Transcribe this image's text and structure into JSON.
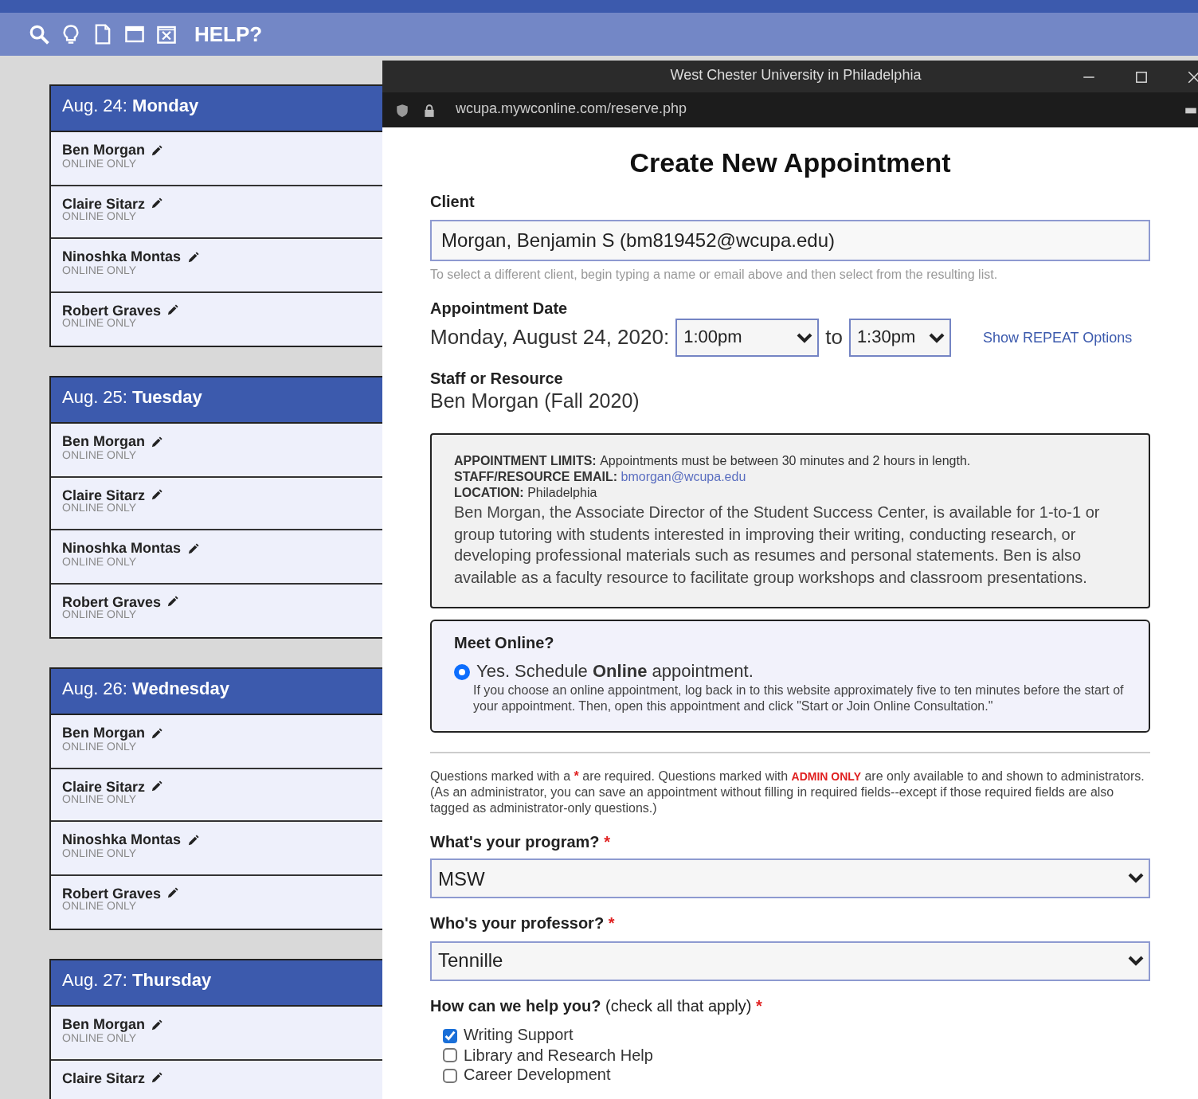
{
  "toolbar": {
    "help": "HELP?"
  },
  "schedule": {
    "days": [
      {
        "date": "Aug. 24:",
        "weekday": "Monday",
        "slots": [
          {
            "name": "Ben Morgan",
            "note": "ONLINE ONLY"
          },
          {
            "name": "Claire Sitarz",
            "note": "ONLINE ONLY"
          },
          {
            "name": "Ninoshka Montas",
            "note": "ONLINE ONLY"
          },
          {
            "name": "Robert Graves",
            "note": "ONLINE ONLY"
          }
        ]
      },
      {
        "date": "Aug. 25:",
        "weekday": "Tuesday",
        "slots": [
          {
            "name": "Ben Morgan",
            "note": "ONLINE ONLY"
          },
          {
            "name": "Claire Sitarz",
            "note": "ONLINE ONLY"
          },
          {
            "name": "Ninoshka Montas",
            "note": "ONLINE ONLY"
          },
          {
            "name": "Robert Graves",
            "note": "ONLINE ONLY"
          }
        ]
      },
      {
        "date": "Aug. 26:",
        "weekday": "Wednesday",
        "slots": [
          {
            "name": "Ben Morgan",
            "note": "ONLINE ONLY"
          },
          {
            "name": "Claire Sitarz",
            "note": "ONLINE ONLY"
          },
          {
            "name": "Ninoshka Montas",
            "note": "ONLINE ONLY"
          },
          {
            "name": "Robert Graves",
            "note": "ONLINE ONLY"
          }
        ]
      },
      {
        "date": "Aug. 27:",
        "weekday": "Thursday",
        "slots": [
          {
            "name": "Ben Morgan",
            "note": "ONLINE ONLY"
          },
          {
            "name": "Claire Sitarz"
          }
        ]
      }
    ]
  },
  "window": {
    "title": "West Chester University in Philadelphia",
    "url": "wcupa.mywconline.com/reserve.php"
  },
  "form": {
    "title": "Create New Appointment",
    "client": {
      "label": "Client",
      "value": "Morgan, Benjamin S (bm819452@wcupa.edu)",
      "hint": "To select a different client, begin typing a name or email above and then select from the resulting list."
    },
    "date": {
      "label": "Appointment Date",
      "value": "Monday, August 24, 2020:",
      "start": "1:00pm",
      "separator": "to",
      "end": "1:30pm",
      "repeat_link": "Show REPEAT Options"
    },
    "staff": {
      "label": "Staff or Resource",
      "value": "Ben Morgan (Fall 2020)"
    },
    "info": {
      "lines": [
        {
          "label": "APPOINTMENT LIMITS:",
          "value": "Appointments must be between 30 minutes and 2 hours in length.",
          "kind": "text"
        },
        {
          "label": "STAFF/RESOURCE EMAIL:",
          "value": "bmorgan@wcupa.edu",
          "kind": "link"
        },
        {
          "label": "LOCATION:",
          "value": "Philadelphia",
          "kind": "text"
        }
      ],
      "description": "Ben Morgan, the Associate Director of the Student Success Center, is available for 1-to-1 or group tutoring with students interested in improving their writing, conducting research, or developing professional materials such as resumes and personal statements. Ben is also available as a faculty resource to facilitate group workshops and classroom presentations."
    },
    "meet_online": {
      "title": "Meet Online?",
      "option": {
        "label": "Yes. Schedule **Online** appointment.",
        "selected": true
      },
      "description": "If you choose an online appointment, log back in to this website approximately five to ten minutes before the start of your appointment. Then, open this appointment and click \"Start or Join Online Consultation.\""
    },
    "notice": {
      "before": "Questions marked with a ",
      "required_mark": "*",
      "middle": " are required. Questions marked with ",
      "admin_tag": "ADMIN ONLY",
      "after": " are only available to and shown to administrators. (As an administrator, you can save an appointment without filling in required fields--except if those required fields are also tagged as administrator-only questions.)"
    },
    "questions": [
      {
        "kind": "select",
        "label": "What's your program?",
        "required_mark": "*",
        "value": "MSW"
      },
      {
        "kind": "select",
        "label": "Who's your professor?",
        "required_mark": "*",
        "value": "Tennille"
      },
      {
        "kind": "checkboxes",
        "label": "How can we help you?",
        "hint": "(check all that apply)",
        "required_mark": "*",
        "options": [
          {
            "label": "Writing Support",
            "checked": true
          },
          {
            "label": "Library and Research Help",
            "checked": false
          },
          {
            "label": "Career Development",
            "checked": false
          }
        ]
      }
    ]
  }
}
